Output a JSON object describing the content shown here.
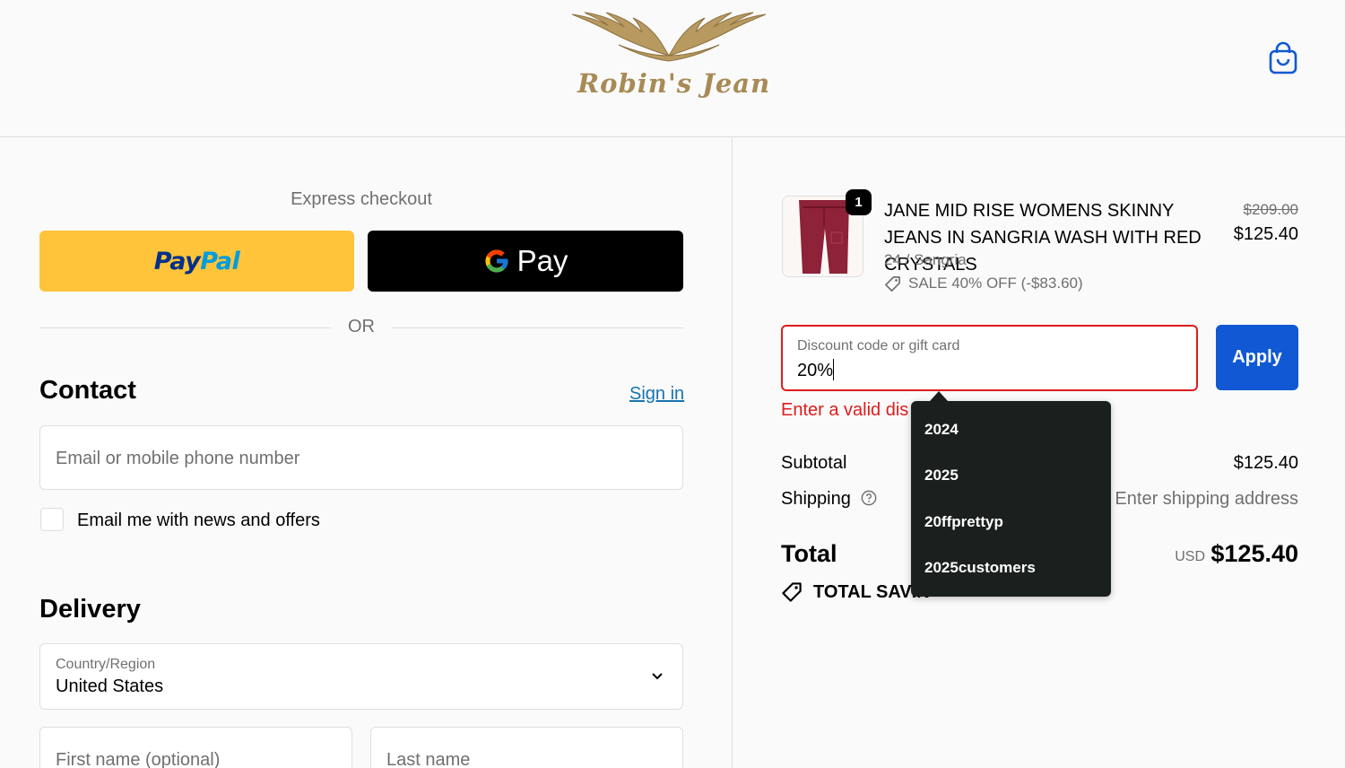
{
  "header": {
    "logo_text": "Robin's Jean",
    "cart_icon": "shopping-bag-icon"
  },
  "express": {
    "label": "Express checkout",
    "paypal_a": "Pay",
    "paypal_b": "Pal",
    "gpay_label": "Pay",
    "or_label": "OR"
  },
  "contact": {
    "heading": "Contact",
    "sign_in": "Sign in",
    "email_placeholder": "Email or mobile phone number",
    "newsletter_label": "Email me with news and offers"
  },
  "delivery": {
    "heading": "Delivery",
    "country_label": "Country/Region",
    "country_value": "United States",
    "first_name_placeholder": "First name (optional)",
    "last_name_placeholder": "Last name"
  },
  "order": {
    "quantity": "1",
    "product_title": "JANE MID RISE WOMENS SKINNY JEANS IN SANGRIA WASH WITH RED CRYSTALS",
    "variant": "24 / Sangria",
    "sale": "SALE 40% OFF (-$83.60)",
    "old_price": "$209.00",
    "price": "$125.40",
    "discount_label": "Discount code or gift card",
    "discount_value": "20%",
    "apply_label": "Apply",
    "error_text": "Enter a valid dis",
    "subtotal_label": "Subtotal",
    "subtotal_value": "$125.40",
    "shipping_label": "Shipping",
    "shipping_value": "Enter shipping address",
    "total_label": "Total",
    "currency": "USD",
    "total_value": "$125.40",
    "savings_label": "TOTAL SAVIN"
  },
  "autocomplete": {
    "items": [
      "2024",
      "2025",
      "20ffprettyp",
      "2025customers"
    ]
  },
  "colors": {
    "paypal_bg": "#ffc439",
    "apply_bg": "#1058d4",
    "error": "#dd1d1d",
    "link": "#1773b0",
    "dropdown_bg": "#1b1f1e"
  }
}
